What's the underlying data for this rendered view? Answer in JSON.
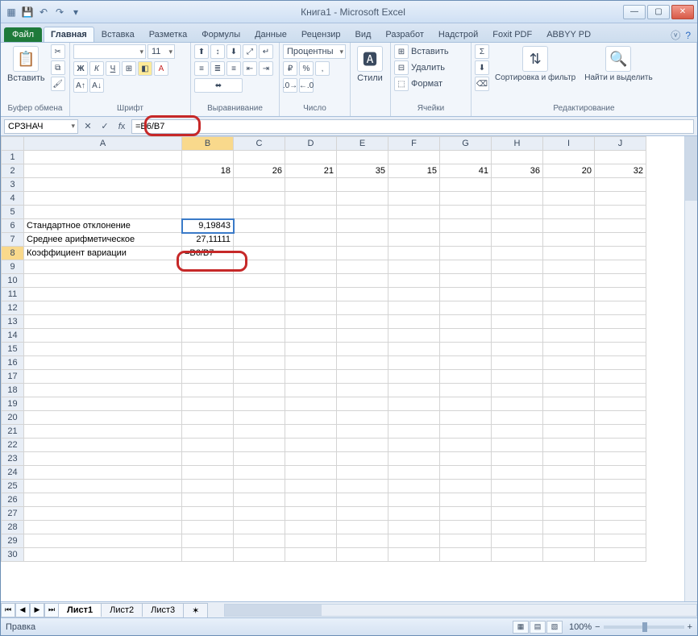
{
  "window": {
    "title": "Книга1 - Microsoft Excel"
  },
  "qat": {
    "save": "💾",
    "undo": "↶",
    "redo": "↷"
  },
  "tabs": {
    "file": "Файл",
    "items": [
      "Главная",
      "Вставка",
      "Разметка",
      "Формулы",
      "Данные",
      "Рецензир",
      "Вид",
      "Разработ",
      "Надстрой",
      "Foxit PDF",
      "ABBYY PD"
    ],
    "active": 0
  },
  "ribbon": {
    "clipboard": {
      "label": "Буфер обмена",
      "paste": "Вставить"
    },
    "font": {
      "label": "Шрифт",
      "name": "",
      "size": "11"
    },
    "alignment": {
      "label": "Выравнивание"
    },
    "number": {
      "label": "Число",
      "format": "Процентны"
    },
    "styles": {
      "label": "Стили",
      "btn": "Стили"
    },
    "cells": {
      "label": "Ячейки",
      "insert": "Вставить",
      "delete": "Удалить",
      "format": "Формат"
    },
    "editing": {
      "label": "Редактирование",
      "sort": "Сортировка и фильтр",
      "find": "Найти и выделить"
    }
  },
  "formula_bar": {
    "name_box": "СРЗНАЧ",
    "formula": "=B6/B7"
  },
  "grid": {
    "columns": [
      "A",
      "B",
      "C",
      "D",
      "E",
      "F",
      "G",
      "H",
      "I",
      "J"
    ],
    "row2": [
      "",
      "18",
      "26",
      "21",
      "35",
      "15",
      "41",
      "36",
      "20",
      "32"
    ],
    "row6": {
      "a": "Стандартное отклонение",
      "b": "9,19843"
    },
    "row7": {
      "a": "Среднее арифметическое",
      "b": "27,11111"
    },
    "row8": {
      "a": "Коэффициент вариации",
      "b": "=B6/B7"
    },
    "active_row": 8,
    "active_col": "B"
  },
  "sheets": {
    "tabs": [
      "Лист1",
      "Лист2",
      "Лист3"
    ],
    "active": 0
  },
  "status": {
    "mode": "Правка",
    "zoom": "100%"
  }
}
